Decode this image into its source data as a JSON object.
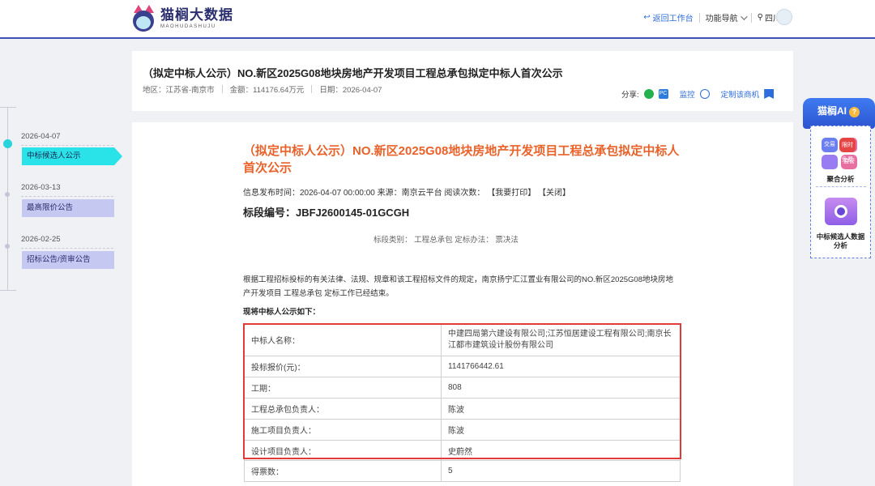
{
  "header": {
    "logo_cn": "猫榈大数据",
    "logo_en": "MAOHUDASHUJU",
    "back_label": "返回工作台",
    "nav_label": "功能导航",
    "region_label": "四川"
  },
  "title_card": {
    "title": "（拟定中标人公示）NO.新区2025G08地块房地产开发项目工程总承包拟定中标人首次公示",
    "region": "地区：江苏省-南京市",
    "amount": "金额：114176.64万元",
    "date": "日期：2026-04-07",
    "share_label": "分享:",
    "monitor_label": "监控",
    "subscribe_label": "定制该商机"
  },
  "timeline": [
    {
      "date": "2026-04-07",
      "label": "中标候选人公示",
      "active": true
    },
    {
      "date": "2026-03-13",
      "label": "最高限价公告",
      "active": false
    },
    {
      "date": "2026-02-25",
      "label": "招标公告/资审公告",
      "active": false
    }
  ],
  "content": {
    "title": "（拟定中标人公示）NO.新区2025G08地块房地产开发项目工程总承包拟定中标人首次公示",
    "info": "信息发布时间：2026-04-07 00:00:00 来源：南京云平台 阅读次数：  【我要打印】 【关闭】",
    "section_no": "标段编号：JBFJ2600145-01GCGH",
    "category": "标段类别：   工程总承包       定标办法：   票决法",
    "paragraph": "根据工程招标投标的有关法律、法规、规章和该工程招标文件的规定，南京扬宁汇江置业有限公司的NO.新区2025G08地块房地产开发项目 工程总承包 定标工作已经结束。",
    "lead": "现将中标人公示如下：",
    "table": [
      {
        "k": "中标人名称：",
        "v": "中建四局第六建设有限公司;江苏恒居建设工程有限公司;南京长江都市建筑设计股份有限公司"
      },
      {
        "k": "投标报价(元)：",
        "v": "1141766442.61"
      },
      {
        "k": "工期：",
        "v": "808"
      },
      {
        "k": "工程总承包负责人：",
        "v": "陈波"
      },
      {
        "k": "施工项目负责人：",
        "v": "陈波"
      },
      {
        "k": "设计项目负责人：",
        "v": "史蔚然"
      },
      {
        "k": "得票数：",
        "v": "5"
      }
    ]
  },
  "ai_panel": {
    "title": "猫榈AI",
    "badge": "限时免费",
    "grid_labels": [
      "交易",
      "",
      "",
      "监管"
    ],
    "item1_label": "聚合分析",
    "item2_label": "中标候选人数据分析"
  }
}
